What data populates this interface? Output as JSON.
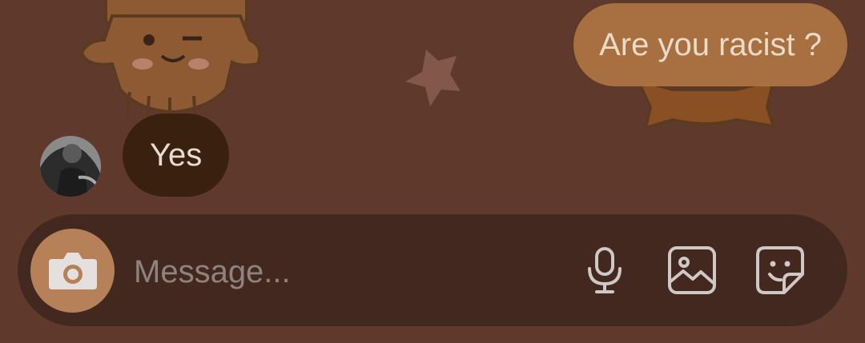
{
  "chat": {
    "sent_message": "Are you racist ?",
    "received_message": "Yes"
  },
  "composer": {
    "placeholder": "Message..."
  },
  "icons": {
    "camera": "camera-icon",
    "microphone": "microphone-icon",
    "gallery": "image-icon",
    "sticker": "sticker-icon"
  },
  "colors": {
    "background": "#5f3a2c",
    "sent_bubble": "#a86f40",
    "received_bubble": "#3a210f",
    "composer": "#432820",
    "camera_button": "#b68058"
  }
}
